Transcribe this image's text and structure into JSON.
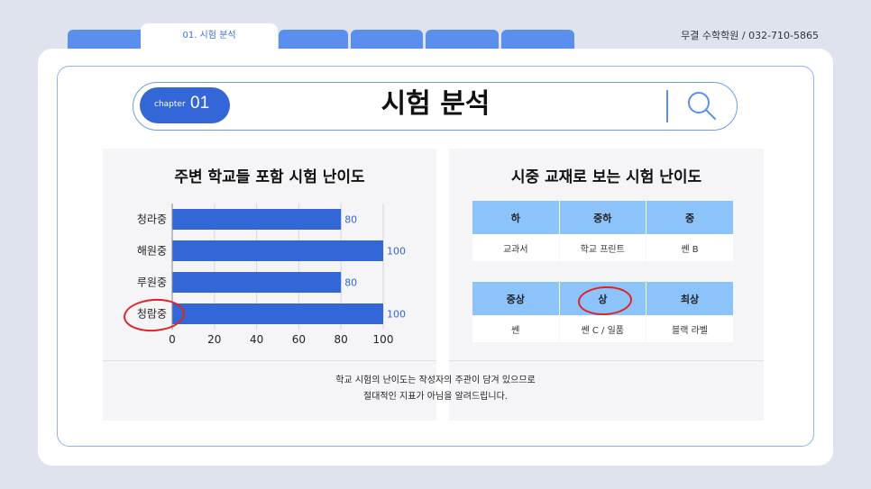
{
  "tabs": [
    {
      "label": "01. 시험 분석",
      "active": true
    },
    {
      "label": "",
      "active": false
    },
    {
      "label": "",
      "active": false
    },
    {
      "label": "",
      "active": false
    },
    {
      "label": "",
      "active": false
    }
  ],
  "contact": "무결 수학학원  /  032-710-5865",
  "header": {
    "chapter_label": "chapter",
    "chapter_number": "01",
    "title": "시험 분석",
    "search_icon": "search-icon"
  },
  "left_panel": {
    "title": "주변 학교들 포함 시험 난이도"
  },
  "chart_data": {
    "type": "bar",
    "orientation": "horizontal",
    "categories": [
      "청라중",
      "해원중",
      "루원중",
      "청람중"
    ],
    "values": [
      80,
      100,
      80,
      100
    ],
    "xlim": [
      0,
      100
    ],
    "xticks": [
      "0",
      "20",
      "40",
      "60",
      "80",
      "100"
    ],
    "highlighted_category": "청람중",
    "bar_color": "#3366d6",
    "label_color": "#3366d6",
    "grid": true
  },
  "right_panel": {
    "title": "시중 교재로 보는 시험 난이도",
    "table1": {
      "headers": [
        "하",
        "중하",
        "중"
      ],
      "values": [
        "교과서",
        "학교 프린트",
        "쎈 B"
      ]
    },
    "table2": {
      "headers": [
        "중상",
        "상",
        "최상"
      ],
      "values": [
        "쎈",
        "쎈 C / 일품",
        "블랙 라벨"
      ],
      "highlighted": "상"
    }
  },
  "note": {
    "line1": "학교 시험의 난이도는 작성자의 주관이 담겨 있으므로",
    "line2": "절대적인 지표가 아님을 알려드립니다."
  },
  "colors": {
    "accent": "#5a8ff0",
    "dark_accent": "#3366d6",
    "table_header": "#8cc3fb",
    "highlight_circle": "#e02424"
  }
}
